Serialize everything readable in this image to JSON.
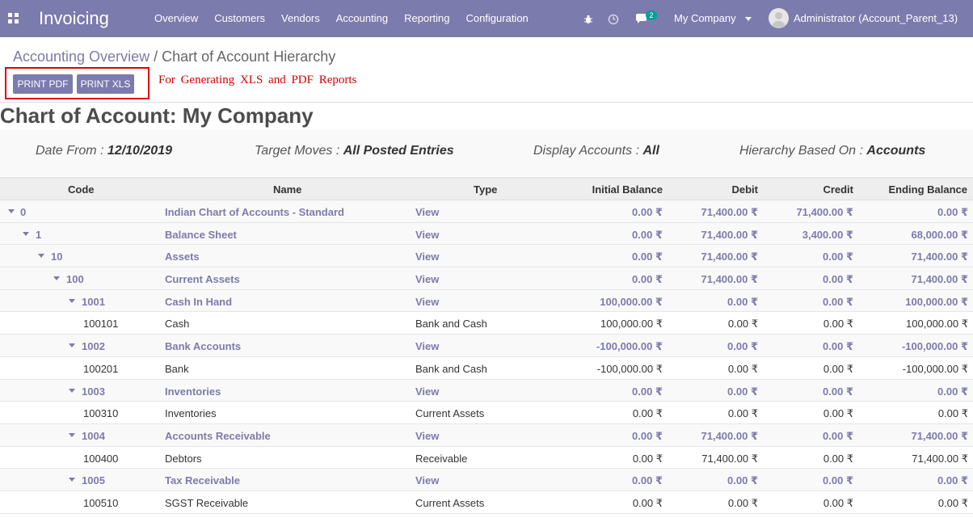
{
  "navbar": {
    "app_title": "Invoicing",
    "menu": [
      "Overview",
      "Customers",
      "Vendors",
      "Accounting",
      "Reporting",
      "Configuration"
    ],
    "messages_count": "2",
    "company": "My Company",
    "user": "Administrator (Account_Parent_13)"
  },
  "breadcrumb": {
    "parent": "Accounting Overview",
    "separator": "/",
    "current": "Chart of Account Hierarchy"
  },
  "toolbar": {
    "print_pdf": "PRINT PDF",
    "print_xls": "PRINT XLS",
    "note": "For Generating XLS and PDF Reports"
  },
  "report": {
    "title": "Chart of Account: My Company",
    "filters": [
      {
        "label": "Date From : ",
        "value": "12/10/2019"
      },
      {
        "label": "Target Moves : ",
        "value": "All Posted Entries"
      },
      {
        "label": "Display Accounts : ",
        "value": "All"
      },
      {
        "label": "Hierarchy Based On : ",
        "value": "Accounts"
      }
    ]
  },
  "table": {
    "headers": {
      "code": "Code",
      "name": "Name",
      "type": "Type",
      "initial": "Initial Balance",
      "debit": "Debit",
      "credit": "Credit",
      "ending": "Ending Balance"
    },
    "rows": [
      {
        "level": 0,
        "parent": true,
        "code": "0",
        "name": "Indian Chart of Accounts - Standard",
        "type": "View",
        "initial": "0.00 ₹",
        "debit": "71,400.00 ₹",
        "credit": "71,400.00 ₹",
        "ending": "0.00 ₹"
      },
      {
        "level": 1,
        "parent": true,
        "code": "1",
        "name": "Balance Sheet",
        "type": "View",
        "initial": "0.00 ₹",
        "debit": "71,400.00 ₹",
        "credit": "3,400.00 ₹",
        "ending": "68,000.00 ₹"
      },
      {
        "level": 2,
        "parent": true,
        "code": "10",
        "name": "Assets",
        "type": "View",
        "initial": "0.00 ₹",
        "debit": "71,400.00 ₹",
        "credit": "0.00 ₹",
        "ending": "71,400.00 ₹"
      },
      {
        "level": 3,
        "parent": true,
        "code": "100",
        "name": "Current Assets",
        "type": "View",
        "initial": "0.00 ₹",
        "debit": "71,400.00 ₹",
        "credit": "0.00 ₹",
        "ending": "71,400.00 ₹"
      },
      {
        "level": 4,
        "parent": true,
        "code": "1001",
        "name": "Cash In Hand",
        "type": "View",
        "initial": "100,000.00 ₹",
        "debit": "0.00 ₹",
        "credit": "0.00 ₹",
        "ending": "100,000.00 ₹"
      },
      {
        "level": 5,
        "parent": false,
        "code": "100101",
        "name": "Cash",
        "type": "Bank and Cash",
        "initial": "100,000.00 ₹",
        "debit": "0.00 ₹",
        "credit": "0.00 ₹",
        "ending": "100,000.00 ₹"
      },
      {
        "level": 4,
        "parent": true,
        "code": "1002",
        "name": "Bank Accounts",
        "type": "View",
        "initial": "-100,000.00 ₹",
        "debit": "0.00 ₹",
        "credit": "0.00 ₹",
        "ending": "-100,000.00 ₹"
      },
      {
        "level": 5,
        "parent": false,
        "code": "100201",
        "name": "Bank",
        "type": "Bank and Cash",
        "initial": "-100,000.00 ₹",
        "debit": "0.00 ₹",
        "credit": "0.00 ₹",
        "ending": "-100,000.00 ₹"
      },
      {
        "level": 4,
        "parent": true,
        "code": "1003",
        "name": "Inventories",
        "type": "View",
        "initial": "0.00 ₹",
        "debit": "0.00 ₹",
        "credit": "0.00 ₹",
        "ending": "0.00 ₹"
      },
      {
        "level": 5,
        "parent": false,
        "code": "100310",
        "name": "Inventories",
        "type": "Current Assets",
        "initial": "0.00 ₹",
        "debit": "0.00 ₹",
        "credit": "0.00 ₹",
        "ending": "0.00 ₹"
      },
      {
        "level": 4,
        "parent": true,
        "code": "1004",
        "name": "Accounts Receivable",
        "type": "View",
        "initial": "0.00 ₹",
        "debit": "71,400.00 ₹",
        "credit": "0.00 ₹",
        "ending": "71,400.00 ₹"
      },
      {
        "level": 5,
        "parent": false,
        "code": "100400",
        "name": "Debtors",
        "type": "Receivable",
        "initial": "0.00 ₹",
        "debit": "71,400.00 ₹",
        "credit": "0.00 ₹",
        "ending": "71,400.00 ₹"
      },
      {
        "level": 4,
        "parent": true,
        "code": "1005",
        "name": "Tax Receivable",
        "type": "View",
        "initial": "0.00 ₹",
        "debit": "0.00 ₹",
        "credit": "0.00 ₹",
        "ending": "0.00 ₹"
      },
      {
        "level": 5,
        "parent": false,
        "code": "100510",
        "name": "SGST Receivable",
        "type": "Current Assets",
        "initial": "0.00 ₹",
        "debit": "0.00 ₹",
        "credit": "0.00 ₹",
        "ending": "0.00 ₹"
      }
    ]
  },
  "colors": {
    "brand": "#7c7bad",
    "badge": "#00a09d",
    "note_red": "#d40000"
  },
  "icons": [
    "apps-icon",
    "bug-icon",
    "clock-icon",
    "chat-icon",
    "caret-down-icon",
    "avatar"
  ]
}
